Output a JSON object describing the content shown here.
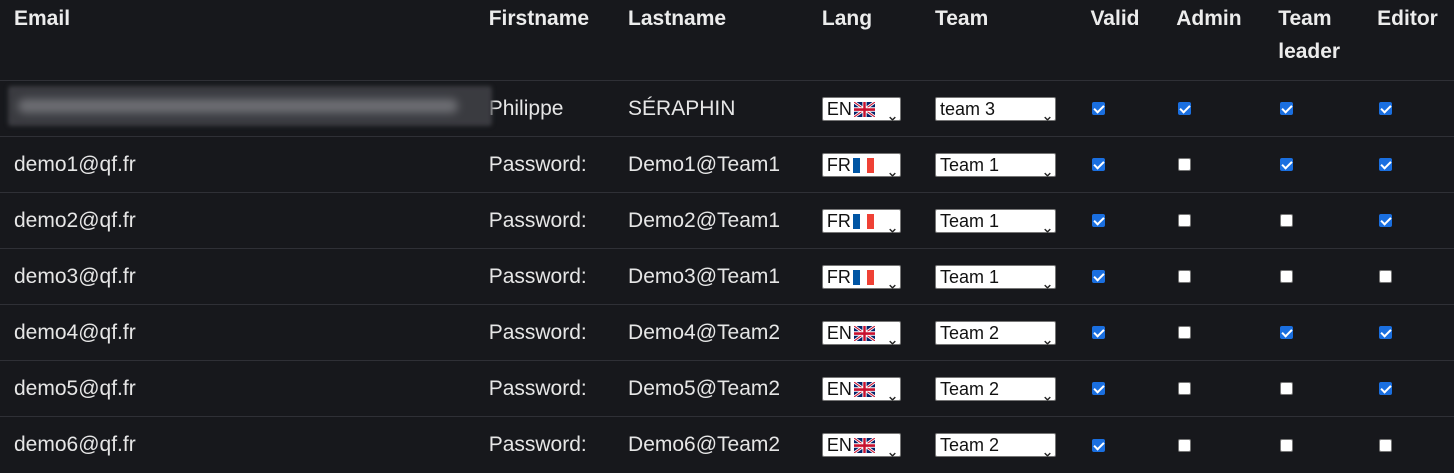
{
  "headers": {
    "email": "Email",
    "firstname": "Firstname",
    "lastname": "Lastname",
    "lang": "Lang",
    "team": "Team",
    "valid": "Valid",
    "admin": "Admin",
    "team_leader_line1": "Team",
    "team_leader_line2": "leader",
    "editor": "Editor"
  },
  "rows": [
    {
      "email": "",
      "email_blurred": true,
      "firstname": "Philippe",
      "lastname": "SÉRAPHIN",
      "lang": "EN",
      "flag": "uk-flag-icon",
      "team": "team 3",
      "valid": true,
      "admin": true,
      "team_leader": true,
      "editor": true
    },
    {
      "email": "demo1@qf.fr",
      "firstname": "Password:",
      "lastname": "Demo1@Team1",
      "lang": "FR",
      "flag": "fr-flag-icon",
      "team": "Team 1",
      "valid": true,
      "admin": false,
      "team_leader": true,
      "editor": true
    },
    {
      "email": "demo2@qf.fr",
      "firstname": "Password:",
      "lastname": "Demo2@Team1",
      "lang": "FR",
      "flag": "fr-flag-icon",
      "team": "Team 1",
      "valid": true,
      "admin": false,
      "team_leader": false,
      "editor": true
    },
    {
      "email": "demo3@qf.fr",
      "firstname": "Password:",
      "lastname": "Demo3@Team1",
      "lang": "FR",
      "flag": "fr-flag-icon",
      "team": "Team 1",
      "valid": true,
      "admin": false,
      "team_leader": false,
      "editor": false
    },
    {
      "email": "demo4@qf.fr",
      "firstname": "Password:",
      "lastname": "Demo4@Team2",
      "lang": "EN",
      "flag": "uk-flag-icon",
      "team": "Team 2",
      "valid": true,
      "admin": false,
      "team_leader": true,
      "editor": true
    },
    {
      "email": "demo5@qf.fr",
      "firstname": "Password:",
      "lastname": "Demo5@Team2",
      "lang": "EN",
      "flag": "uk-flag-icon",
      "team": "Team 2",
      "valid": true,
      "admin": false,
      "team_leader": false,
      "editor": true
    },
    {
      "email": "demo6@qf.fr",
      "firstname": "Password:",
      "lastname": "Demo6@Team2",
      "lang": "EN",
      "flag": "uk-flag-icon",
      "team": "Team 2",
      "valid": true,
      "admin": false,
      "team_leader": false,
      "editor": false
    }
  ],
  "colors": {
    "background": "#17181c",
    "checkbox_checked": "#1a6fe0",
    "row_border": "#2f3036"
  }
}
